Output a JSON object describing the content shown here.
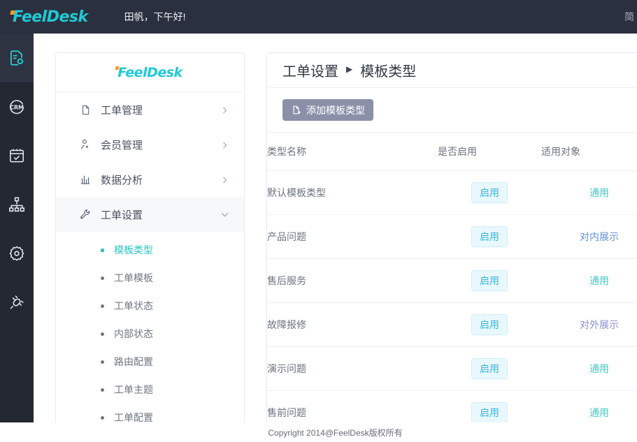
{
  "topbar": {
    "brand": "FeelDesk",
    "greeting": "田帆，下午好!",
    "language": "简"
  },
  "rail": {
    "items": [
      {
        "name": "ticket-settings",
        "icon": "document-gear-icon",
        "active": true
      },
      {
        "name": "crm",
        "icon": "crm-circle-icon",
        "active": false
      },
      {
        "name": "calendar",
        "icon": "calendar-check-icon",
        "active": false
      },
      {
        "name": "organization",
        "icon": "sitemap-icon",
        "active": false
      },
      {
        "name": "settings",
        "icon": "gear-icon",
        "active": false
      },
      {
        "name": "integrations",
        "icon": "plug-connector-icon",
        "active": false
      }
    ]
  },
  "sidebar": {
    "brand": "FeelDesk",
    "items": [
      {
        "label": "工单管理",
        "icon": "clipboard-icon",
        "chevron": "chevron-right-icon"
      },
      {
        "label": "会员管理",
        "icon": "user-icon",
        "chevron": "chevron-right-icon"
      },
      {
        "label": "数据分析",
        "icon": "bar-chart-icon",
        "chevron": "chevron-right-icon"
      },
      {
        "label": "工单设置",
        "icon": "wrench-icon",
        "chevron": "chevron-down-icon"
      }
    ],
    "submenu": [
      {
        "label": "模板类型",
        "active": true
      },
      {
        "label": "工单模板",
        "active": false
      },
      {
        "label": "工单状态",
        "active": false
      },
      {
        "label": "内部状态",
        "active": false
      },
      {
        "label": "路由配置",
        "active": false
      },
      {
        "label": "工单主题",
        "active": false
      },
      {
        "label": "工单配置",
        "active": false
      }
    ]
  },
  "main": {
    "breadcrumb": {
      "parent": "工单设置",
      "separator": "▶",
      "current": "模板类型"
    },
    "toolbar": {
      "add_label": "添加模板类型",
      "add_icon": "file-plus-icon"
    },
    "table": {
      "columns": [
        "类型名称",
        "是否启用",
        "适用对象"
      ],
      "rows": [
        {
          "name": "默认模板类型",
          "enabled": "启用",
          "target": "通用",
          "target_style": "general"
        },
        {
          "name": "产品问题",
          "enabled": "启用",
          "target": "对内展示",
          "target_style": "internal"
        },
        {
          "name": "售后服务",
          "enabled": "启用",
          "target": "通用",
          "target_style": "general"
        },
        {
          "name": "故障报修",
          "enabled": "启用",
          "target": "对外展示",
          "target_style": "external"
        },
        {
          "name": "演示问题",
          "enabled": "启用",
          "target": "通用",
          "target_style": "general"
        },
        {
          "name": "售前问题",
          "enabled": "启用",
          "target": "通用",
          "target_style": "general"
        }
      ]
    }
  },
  "footer": {
    "copyright": "Copyright 2014@FeelDesk版权所有"
  },
  "colors": {
    "brand_cyan": "#21c9d4",
    "brand_accent": "#f49b2a",
    "topbar_bg": "#2b3040",
    "rail_bg": "#242833",
    "badge_text": "#36b7e4",
    "target_general": "#3ccac6",
    "target_internal": "#5f90d8",
    "target_external": "#8a8ed2",
    "button_bg": "#8b90a8"
  }
}
